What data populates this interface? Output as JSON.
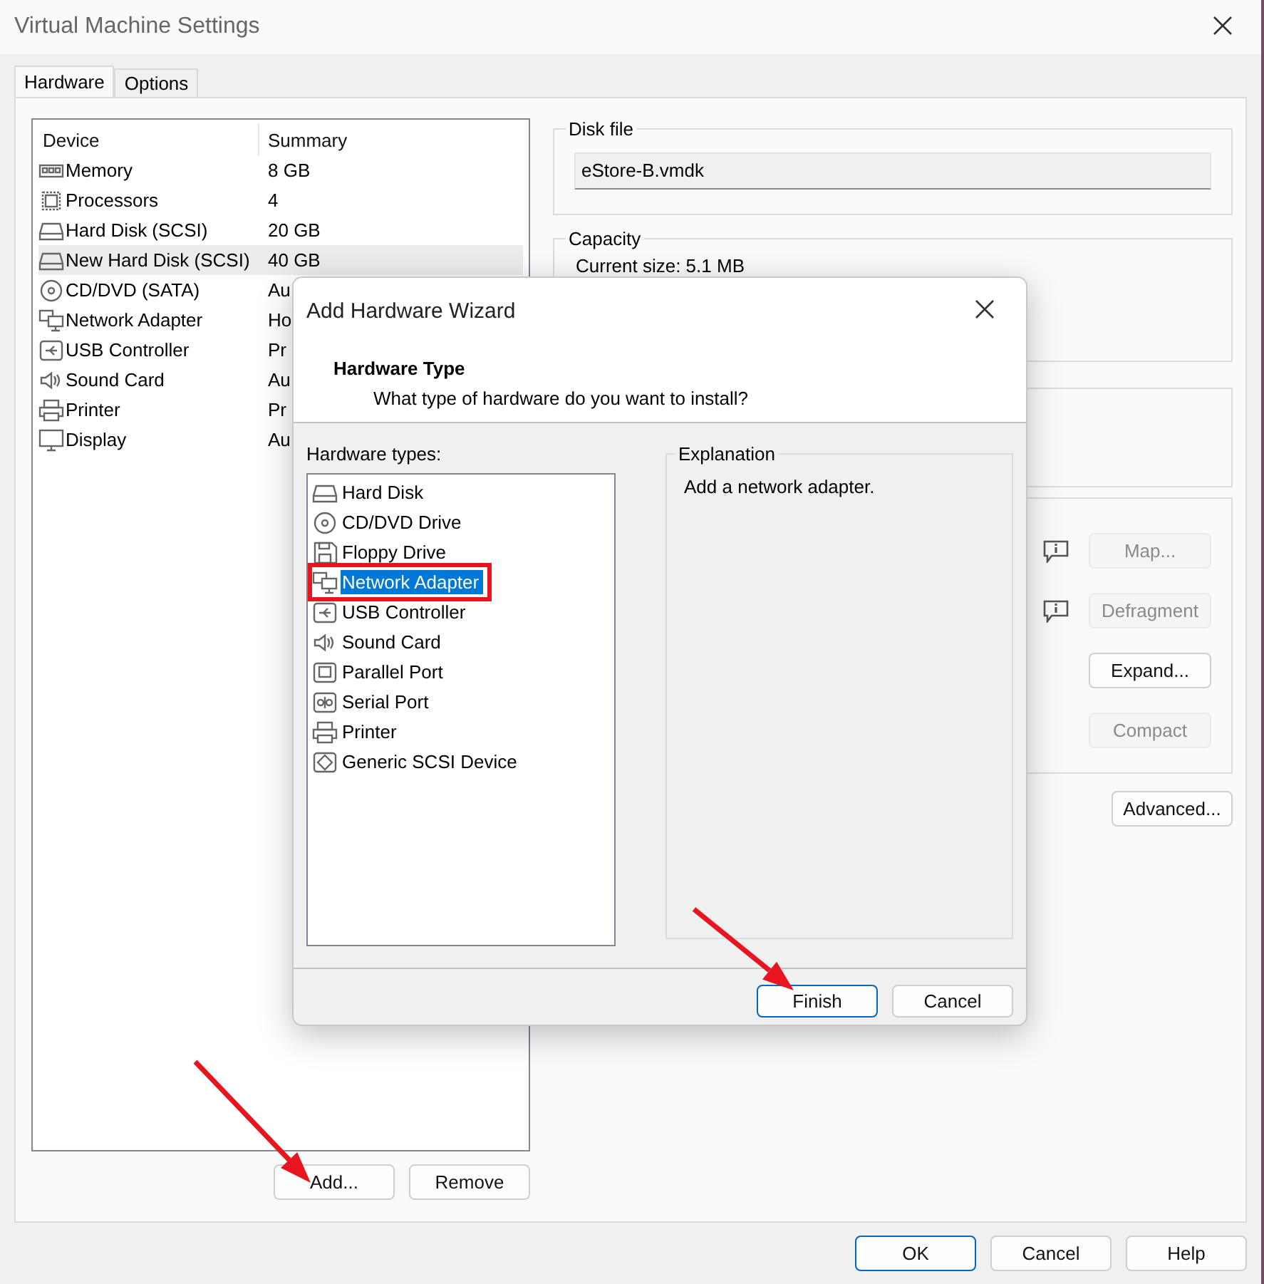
{
  "window": {
    "title": "Virtual Machine Settings"
  },
  "tabs": [
    {
      "label": "Hardware",
      "selected": true
    },
    {
      "label": "Options",
      "selected": false
    }
  ],
  "device_table": {
    "columns": [
      "Device",
      "Summary"
    ],
    "rows": [
      {
        "kind": "memory",
        "device": "Memory",
        "summary": "8 GB",
        "selected": false
      },
      {
        "kind": "cpu",
        "device": "Processors",
        "summary": "4",
        "selected": false
      },
      {
        "kind": "disk",
        "device": "Hard Disk (SCSI)",
        "summary": "20 GB",
        "selected": false
      },
      {
        "kind": "disk",
        "device": "New Hard Disk (SCSI)",
        "summary": "40 GB",
        "selected": true
      },
      {
        "kind": "cdrom",
        "device": "CD/DVD (SATA)",
        "summary": "Au",
        "selected": false
      },
      {
        "kind": "network",
        "device": "Network Adapter",
        "summary": "Ho",
        "selected": false
      },
      {
        "kind": "usb",
        "device": "USB Controller",
        "summary": "Pr",
        "selected": false
      },
      {
        "kind": "sound",
        "device": "Sound Card",
        "summary": "Au",
        "selected": false
      },
      {
        "kind": "printer",
        "device": "Printer",
        "summary": "Pr",
        "selected": false
      },
      {
        "kind": "display",
        "device": "Display",
        "summary": "Au",
        "selected": false
      }
    ]
  },
  "list_buttons": [
    "Add...",
    "Remove"
  ],
  "disk_file": {
    "label": "Disk file",
    "value": "eStore-B.vmdk"
  },
  "capacity": {
    "label": "Capacity",
    "current_size": "Current size: 5.1 MB"
  },
  "disk_actions": [
    {
      "label": "Map...",
      "disabled": true,
      "info": true
    },
    {
      "label": "Defragment",
      "disabled": true,
      "info": true
    },
    {
      "label": "Expand...",
      "disabled": false,
      "info": false
    },
    {
      "label": "Compact",
      "disabled": true,
      "info": false
    }
  ],
  "advanced_button": "Advanced...",
  "footer_buttons": [
    {
      "label": "OK",
      "default": true
    },
    {
      "label": "Cancel",
      "default": false
    },
    {
      "label": "Help",
      "default": false
    }
  ],
  "wizard": {
    "title": "Add Hardware Wizard",
    "heading": "Hardware Type",
    "subtitle": "What type of hardware do you want to install?",
    "list_label": "Hardware types:",
    "types": [
      {
        "kind": "disk",
        "label": "Hard Disk",
        "selected": false,
        "outlined": false
      },
      {
        "kind": "cdrom",
        "label": "CD/DVD Drive",
        "selected": false,
        "outlined": false
      },
      {
        "kind": "floppy",
        "label": "Floppy Drive",
        "selected": false,
        "outlined": false
      },
      {
        "kind": "network",
        "label": "Network Adapter",
        "selected": true,
        "outlined": true
      },
      {
        "kind": "usb",
        "label": "USB Controller",
        "selected": false,
        "outlined": false
      },
      {
        "kind": "sound",
        "label": "Sound Card",
        "selected": false,
        "outlined": false
      },
      {
        "kind": "parallel",
        "label": "Parallel Port",
        "selected": false,
        "outlined": false
      },
      {
        "kind": "serial",
        "label": "Serial Port",
        "selected": false,
        "outlined": false
      },
      {
        "kind": "printer",
        "label": "Printer",
        "selected": false,
        "outlined": false
      },
      {
        "kind": "scsi",
        "label": "Generic SCSI Device",
        "selected": false,
        "outlined": false
      }
    ],
    "explanation_label": "Explanation",
    "explanation": "Add a network adapter.",
    "buttons": [
      {
        "label": "Finish",
        "default": true
      },
      {
        "label": "Cancel",
        "default": false
      }
    ]
  }
}
